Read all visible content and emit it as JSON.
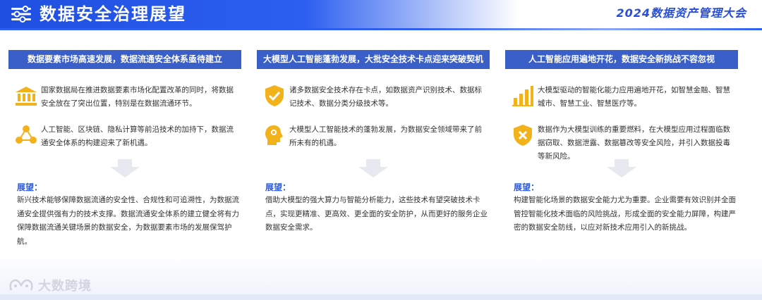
{
  "header": {
    "title": "数据安全治理展望",
    "event": "2024数据资产管理大会"
  },
  "colors": {
    "header_blue": "#1f4fe0",
    "banner_blue": "#3a5fc8",
    "icon_gold": "#f2b21c",
    "outlook_blue": "#2e5ad6"
  },
  "columns": [
    {
      "banner": "数据要素市场高速发展，数据流通安全体系亟待建立",
      "items": [
        {
          "icon": "bank-icon",
          "text": "国家数据局在推进数据要素市场化配置改革的同时，将数据安全放在了突出位置，特别是在数据流通环节。"
        },
        {
          "icon": "network-icon",
          "text": "人工智能、区块链、隐私计算等前沿技术的加持下，数据流通安全体系的构建迎来了新机遇。"
        }
      ],
      "outlook_label": "展望：",
      "outlook_text": "新兴技术能够保障数据流通的安全性、合规性和可追溯性，为数据流通安全提供强有力的技术支撑。数据流通安全体系的建立健全将有力保障数据流通关键场景的数据安全，为数据要素市场的发展保驾护航。"
    },
    {
      "banner": "大模型人工智能蓬勃发展，大批安全技术卡点迎来突破契机",
      "items": [
        {
          "icon": "shield-check-icon",
          "text": "诸多数据安全技术存在卡点，如数据资产识别技术、数据标记技术、数据分类分级技术等。"
        },
        {
          "icon": "ai-head-icon",
          "text": "大模型人工智能技术的蓬勃发展，为数据安全领域带来了前所未有的机遇。"
        }
      ],
      "outlook_label": "展望：",
      "outlook_text": "借助大模型的强大算力与智能分析能力，这些技术有望突破技术卡点，实现更精准、更高效、更全面的安全防护，从而更好的服务企业数据安全需求。"
    },
    {
      "banner": "人工智能应用遍地开花，数据安全新挑战不容忽视",
      "items": [
        {
          "icon": "bar-chart-icon",
          "text": "大模型驱动的智能化能力应用遍地开花，如智慧金融、智慧城市、智慧工业、智慧医疗等。"
        },
        {
          "icon": "shield-x-icon",
          "text": "数据作为大模型训练的重要燃料，在大模型应用过程面临数据窃取、数据泄露、数据篡改等安全风险，并引入数据投毒等新风险。"
        }
      ],
      "outlook_label": "展望：",
      "outlook_text": "构建智能化场景的数据安全能力尤为重要。企业需要有效识别并全面管控智能化技术面临的风险挑战，形成全面的安全能力屏障，构建严密的数据安全防线，以应对新技术应用引入的新挑战。"
    }
  ],
  "watermark": {
    "text": "大数跨境"
  }
}
